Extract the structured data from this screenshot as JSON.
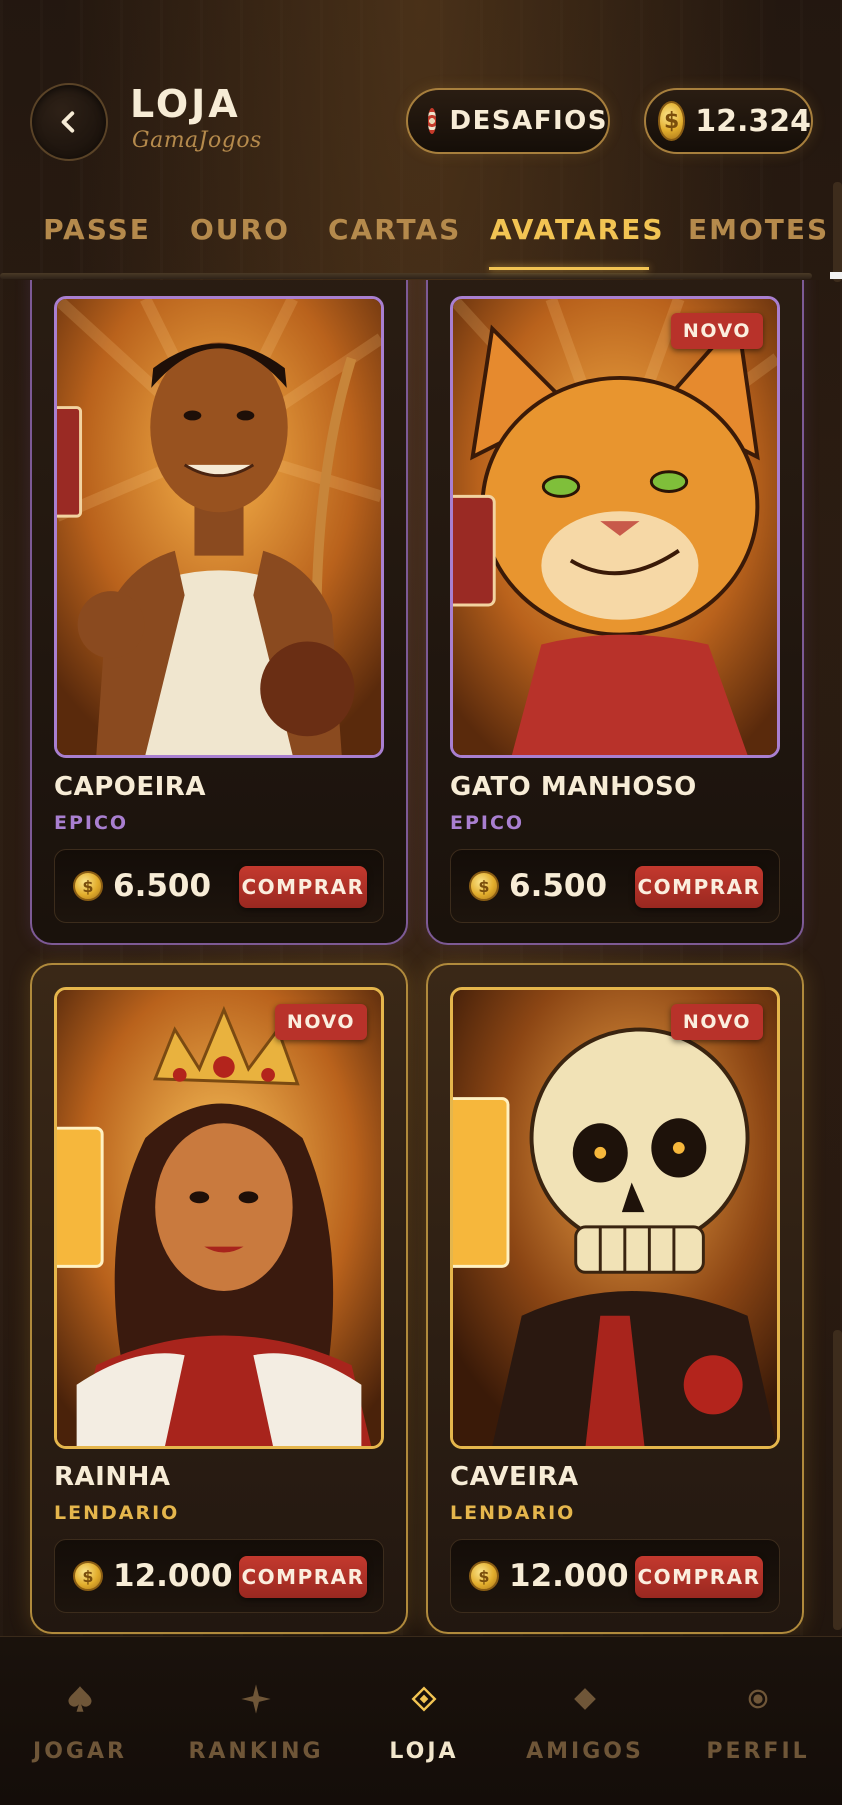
{
  "header": {
    "title": "LOJA",
    "subtitle": "GamaJogos",
    "back_icon": "chevron-left-icon",
    "challenges_label": "DESAFIOS",
    "challenges_icon": "target-icon",
    "coin_balance": "12.324",
    "coin_symbol": "$"
  },
  "tabs": [
    {
      "label": "PASSE",
      "active": false
    },
    {
      "label": "OURO",
      "active": false
    },
    {
      "label": "CARTAS",
      "active": false
    },
    {
      "label": "AVATARES",
      "active": true
    },
    {
      "label": "EMOTES",
      "active": false
    }
  ],
  "cards": [
    {
      "name": "CAPOEIRA",
      "rarity": "EPICO",
      "price": "6.500",
      "buy_label": "COMPRAR",
      "badge": "",
      "art_icon": "capoeira-avatar-icon"
    },
    {
      "name": "GATO MANHOSO",
      "rarity": "EPICO",
      "price": "6.500",
      "buy_label": "COMPRAR",
      "badge": "NOVO",
      "art_icon": "cat-avatar-icon"
    },
    {
      "name": "RAINHA",
      "rarity": "LENDARIO",
      "price": "12.000",
      "buy_label": "COMPRAR",
      "badge": "NOVO",
      "art_icon": "queen-avatar-icon"
    },
    {
      "name": "CAVEIRA",
      "rarity": "LENDARIO",
      "price": "12.000",
      "buy_label": "COMPRAR",
      "badge": "NOVO",
      "art_icon": "skull-avatar-icon"
    }
  ],
  "coin_symbol": "$",
  "nav": [
    {
      "label": "JOGAR",
      "icon": "spade-icon",
      "active": false
    },
    {
      "label": "RANKING",
      "icon": "sparkle-icon",
      "active": false
    },
    {
      "label": "LOJA",
      "icon": "diamond-icon",
      "active": true
    },
    {
      "label": "AMIGOS",
      "icon": "diamond-filled-icon",
      "active": false
    },
    {
      "label": "PERFIL",
      "icon": "circle-icon",
      "active": false
    }
  ],
  "colors": {
    "background": "#241810",
    "gold_accent": "#f2c453",
    "epic": "#a97fd0",
    "legendary": "#e5b64c",
    "buy_button": "#c4392e"
  }
}
